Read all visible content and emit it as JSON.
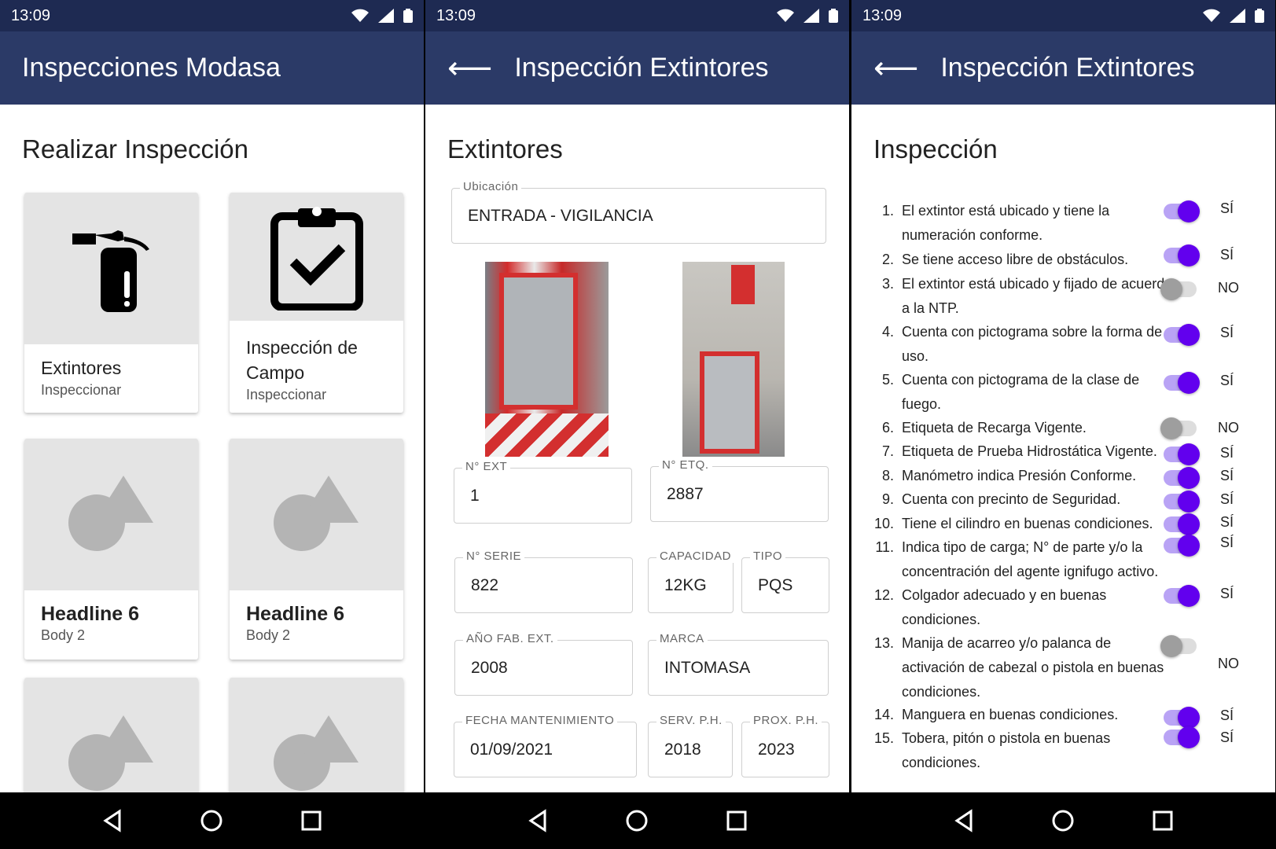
{
  "status": {
    "time": "13:09"
  },
  "screen1": {
    "appbar_title": "Inspecciones Modasa",
    "section_title": "Realizar Inspección",
    "cards": [
      {
        "title": "Extintores",
        "subtitle": "Inspeccionar",
        "icon": "fire-extinguisher-icon"
      },
      {
        "title": "Inspección de Campo",
        "subtitle": "Inspeccionar",
        "icon": "clipboard-check-icon"
      },
      {
        "title": "Headline 6",
        "subtitle": "Body 2",
        "icon": "shapes-placeholder-icon"
      },
      {
        "title": "Headline 6",
        "subtitle": "Body 2",
        "icon": "shapes-placeholder-icon"
      }
    ]
  },
  "screen2": {
    "appbar_title": "Inspección Extintores",
    "section_title": "Extintores",
    "ubicacion": {
      "label": "Ubicación",
      "value": "ENTRADA - VIGILANCIA"
    },
    "n_ext": {
      "label": "N° EXT",
      "value": "1"
    },
    "n_etq": {
      "label": "N° ETQ.",
      "value": "2887"
    },
    "n_serie": {
      "label": "N° SERIE",
      "value": "822"
    },
    "capacidad": {
      "label": "CAPACIDAD",
      "value": "12KG"
    },
    "tipo": {
      "label": "TIPO",
      "value": "PQS"
    },
    "anio_fab": {
      "label": "AÑO FAB. EXT.",
      "value": "2008"
    },
    "marca": {
      "label": "MARCA",
      "value": "INTOMASA"
    },
    "fecha_mant": {
      "label": "FECHA MANTENIMIENTO",
      "value": "01/09/2021"
    },
    "serv_ph": {
      "label": "SERV. P.H.",
      "value": "2018"
    },
    "prox_ph": {
      "label": "PROX. P.H.",
      "value": "2023"
    }
  },
  "screen3": {
    "appbar_title": "Inspección Extintores",
    "section_title": "Inspección",
    "items": [
      {
        "num": "1.",
        "text": "El extintor está ubicado y tiene la numeración conforme.",
        "answer": "SÍ",
        "on": true
      },
      {
        "num": "2.",
        "text": "Se tiene acceso libre de obstáculos.",
        "answer": "SÍ",
        "on": true
      },
      {
        "num": "3.",
        "text": "El extintor está ubicado y fijado de acuerdo a la NTP.",
        "answer": "NO",
        "on": false
      },
      {
        "num": "4.",
        "text": "Cuenta con pictograma sobre la forma de uso.",
        "answer": "SÍ",
        "on": true
      },
      {
        "num": "5.",
        "text": "Cuenta con pictograma de la clase de fuego.",
        "answer": "SÍ",
        "on": true
      },
      {
        "num": "6.",
        "text": "Etiqueta de Recarga Vigente.",
        "answer": "NO",
        "on": false
      },
      {
        "num": "7.",
        "text": "Etiqueta de Prueba Hidrostática Vigente.",
        "answer": "SÍ",
        "on": true
      },
      {
        "num": "8.",
        "text": "Manómetro indica Presión Conforme.",
        "answer": "SÍ",
        "on": true
      },
      {
        "num": "9.",
        "text": "Cuenta con precinto de Seguridad.",
        "answer": "SÍ",
        "on": true
      },
      {
        "num": "10.",
        "text": "Tiene el cilindro en buenas condiciones.",
        "answer": "SÍ",
        "on": true
      },
      {
        "num": "11.",
        "text": "Indica tipo de carga; N° de parte y/o la concentración del agente ignifugo activo.",
        "answer": "SÍ",
        "on": true
      },
      {
        "num": "12.",
        "text": "Colgador adecuado y en buenas condiciones.",
        "answer": "SÍ",
        "on": true
      },
      {
        "num": "13.",
        "text": "Manija de acarreo y/o palanca de activación de cabezal o pistola en buenas condiciones.",
        "answer": "NO",
        "on": false
      },
      {
        "num": "14.",
        "text": "Manguera en buenas condiciones.",
        "answer": "SÍ",
        "on": true
      },
      {
        "num": "15.",
        "text": "Tobera, pitón o pistola en buenas condiciones.",
        "answer": "SÍ",
        "on": true
      }
    ]
  }
}
